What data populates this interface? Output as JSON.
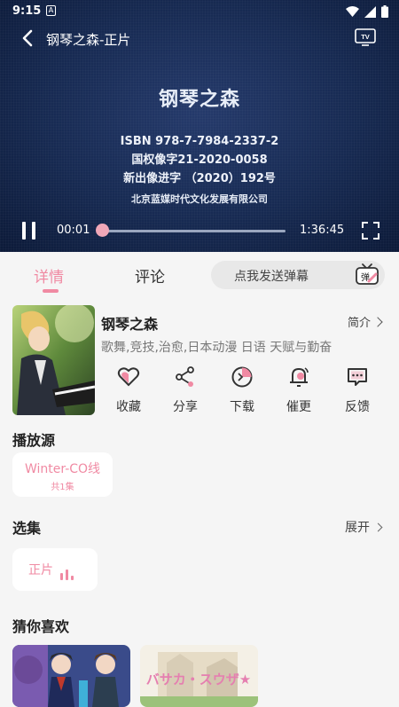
{
  "status_bar": {
    "time": "9:15",
    "notification": "A"
  },
  "player": {
    "title": "钢琴之森-正片",
    "cover_title": "钢琴之森",
    "cover_lines": [
      "ISBN 978-7-7984-2337-2",
      "国权像字21-2020-0058",
      "新出像进字 （2020）192号"
    ],
    "cover_company": "北京蓝媒时代文化发展有限公司",
    "current_time": "00:01",
    "duration": "1:36:45",
    "progress": 0.0002
  },
  "tabs": {
    "details": "详情",
    "comments": "评论"
  },
  "danmu": {
    "placeholder": "点我发送弹幕",
    "button": "弹"
  },
  "anime": {
    "title": "钢琴之森",
    "intro_label": "简介",
    "tags": "歌舞,竞技,治愈,日本动漫 日语 天赋与勤奋"
  },
  "actions": [
    {
      "label": "收藏",
      "icon": "heart-icon"
    },
    {
      "label": "分享",
      "icon": "share-icon"
    },
    {
      "label": "下载",
      "icon": "download-icon"
    },
    {
      "label": "催更",
      "icon": "bell-icon"
    },
    {
      "label": "反馈",
      "icon": "feedback-icon"
    }
  ],
  "sources": {
    "title": "播放源",
    "name": "Winter-CO线",
    "count": "共1集"
  },
  "episodes": {
    "title": "选集",
    "expand": "展开",
    "current": "正片"
  },
  "recommend": {
    "title": "猜你喜欢",
    "item2_caption": "バサカ・スウザ★"
  },
  "colors": {
    "accent": "#f08aa3",
    "video_bg": "#172a52"
  }
}
